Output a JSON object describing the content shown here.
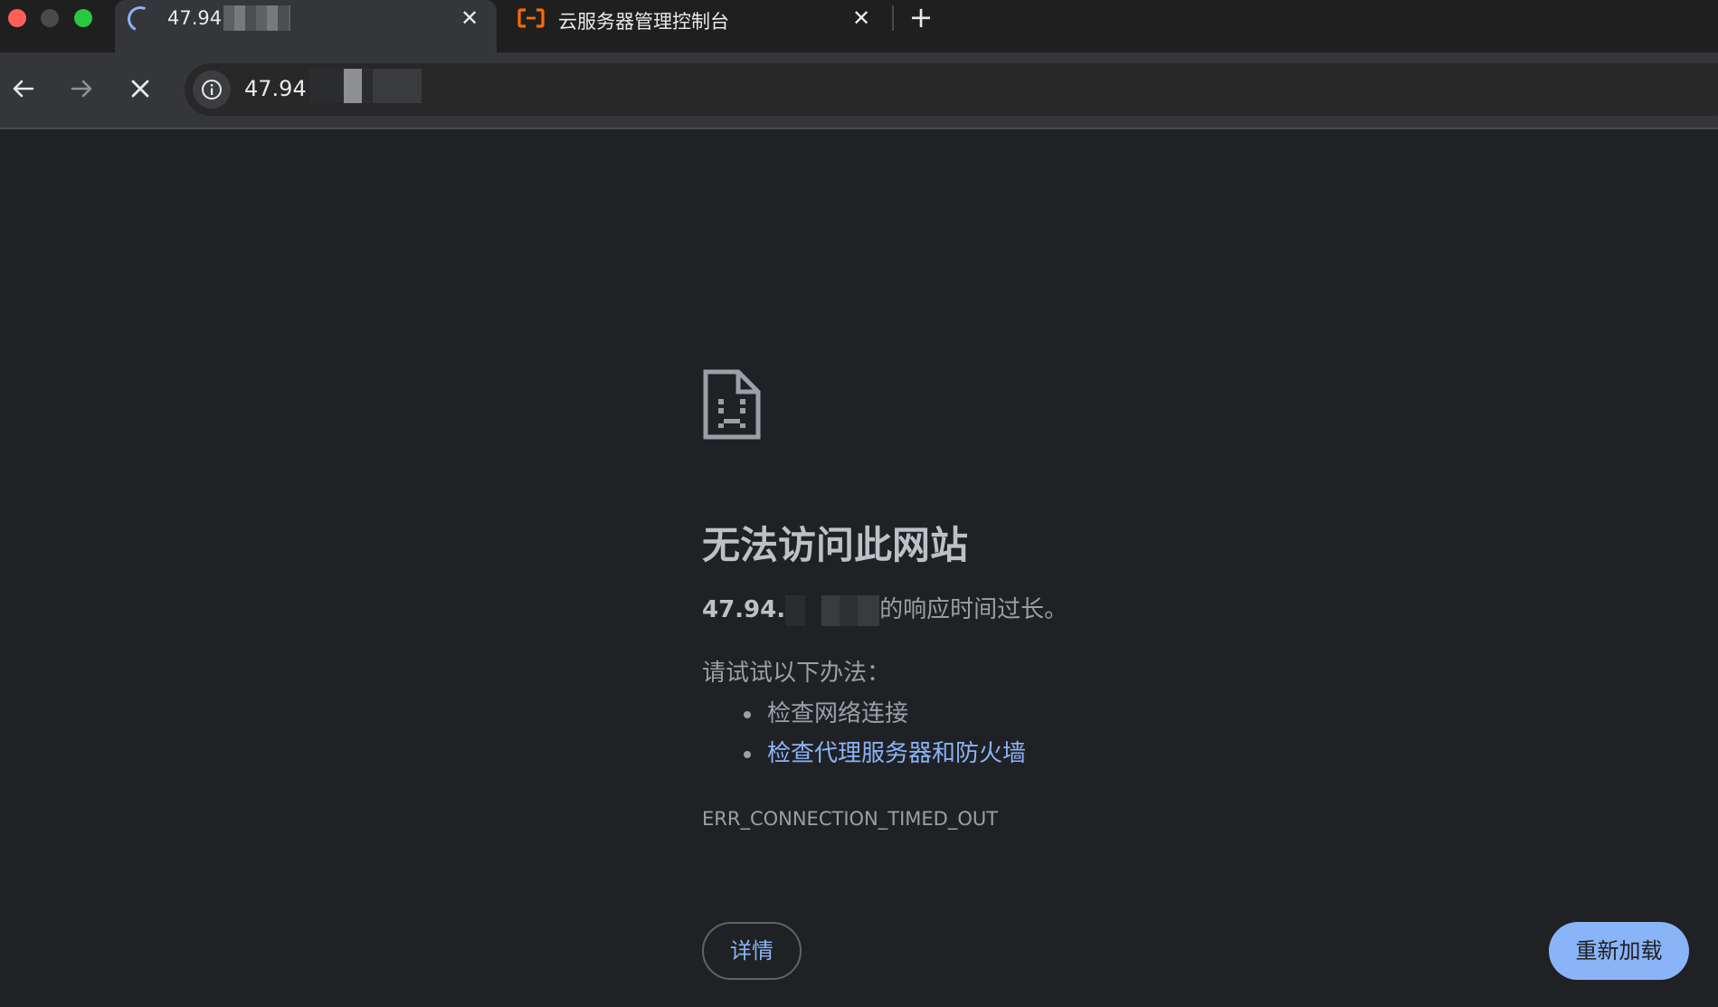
{
  "window": {
    "buttons": [
      "close",
      "minimize",
      "maximize"
    ]
  },
  "tabs": [
    {
      "title": "47.94",
      "state": "loading",
      "active": true,
      "icon": "loading-spinner-icon"
    },
    {
      "title": "云服务器管理控制台",
      "state": "loaded",
      "active": false,
      "icon": "aliyun-logo-icon"
    }
  ],
  "toolbar": {
    "back_icon": "arrow-left-icon",
    "forward_icon": "arrow-right-icon",
    "stop_icon": "close-icon",
    "site_info_icon": "info-icon",
    "url": "47.94"
  },
  "error": {
    "icon": "sad-page-icon",
    "title": "无法访问此网站",
    "host": "47.94.",
    "description_suffix": "的响应时间过长。",
    "try_label": "请试试以下办法：",
    "suggestions": [
      {
        "text": "检查网络连接",
        "is_link": false
      },
      {
        "text": "检查代理服务器和防火墙",
        "is_link": true
      }
    ],
    "code": "ERR_CONNECTION_TIMED_OUT",
    "details_label": "详情",
    "reload_label": "重新加载"
  },
  "colors": {
    "accent": "#8ab4f8",
    "background": "#202124",
    "toolbar": "#35363a",
    "traffic_close": "#ff5f57",
    "traffic_max": "#28c840",
    "aliyun_orange": "#ff6a00"
  }
}
